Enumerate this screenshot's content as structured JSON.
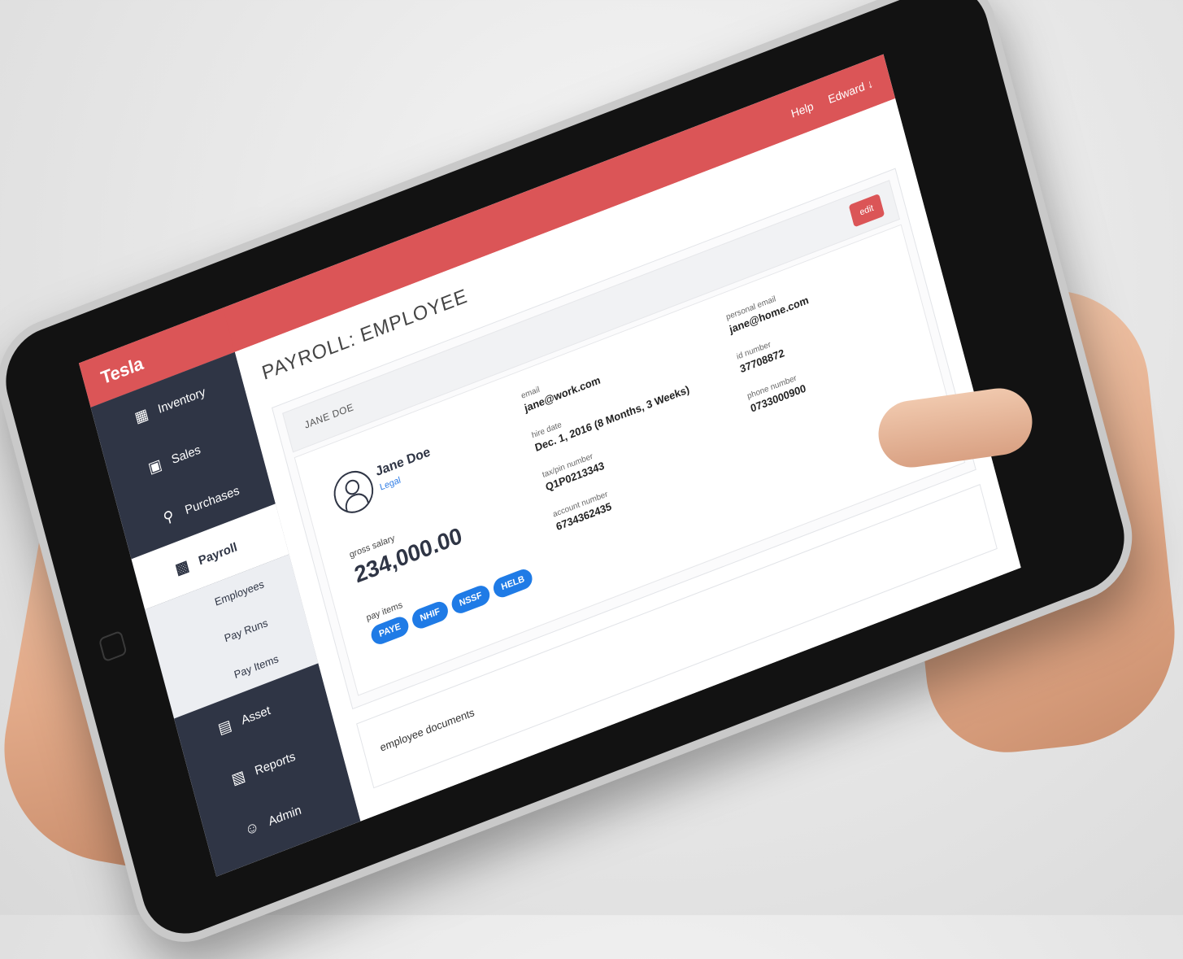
{
  "app": {
    "brand": "Tesla",
    "topnav": {
      "help": "Help",
      "user": "Edward",
      "user_chevron": "chevron-down-icon"
    },
    "accent_color": "#db5557",
    "sidebar_color": "#2f3545"
  },
  "sidebar": {
    "items": [
      {
        "label": "Inventory",
        "icon": "store-icon"
      },
      {
        "label": "Sales",
        "icon": "receipt-icon"
      },
      {
        "label": "Purchases",
        "icon": "cart-icon"
      },
      {
        "label": "Payroll",
        "icon": "id-card-icon",
        "active": true
      },
      {
        "label": "Asset",
        "icon": "building-icon"
      },
      {
        "label": "Reports",
        "icon": "document-icon"
      },
      {
        "label": "Admin",
        "icon": "user-icon"
      }
    ],
    "payroll_submenu": [
      "Employees",
      "Pay Runs",
      "Pay Items"
    ]
  },
  "page": {
    "title": "PAYROLL: EMPLOYEE",
    "panel_name": "JANE DOE",
    "edit_label": "edit"
  },
  "employee": {
    "name": "Jane Doe",
    "role": "Legal",
    "gross_salary_label": "gross salary",
    "gross_salary": "234,000.00",
    "pay_items_label": "pay items",
    "pay_items": [
      "PAYE",
      "NHIF",
      "NSSF",
      "HELB"
    ],
    "fields": {
      "email_label": "email",
      "email": "jane@work.com",
      "hire_date_label": "hire date",
      "hire_date": "Dec. 1, 2016 (8 Months, 3 Weeks)",
      "tax_pin_label": "tax/pin number",
      "tax_pin": "Q1P0213343",
      "account_label": "account number",
      "account": "6734362435",
      "personal_email_label": "personal email",
      "personal_email": "jane@home.com",
      "id_label": "id number",
      "id": "37708872",
      "phone_label": "phone number",
      "phone": "0733000900"
    }
  },
  "documents": {
    "title": "employee documents"
  }
}
